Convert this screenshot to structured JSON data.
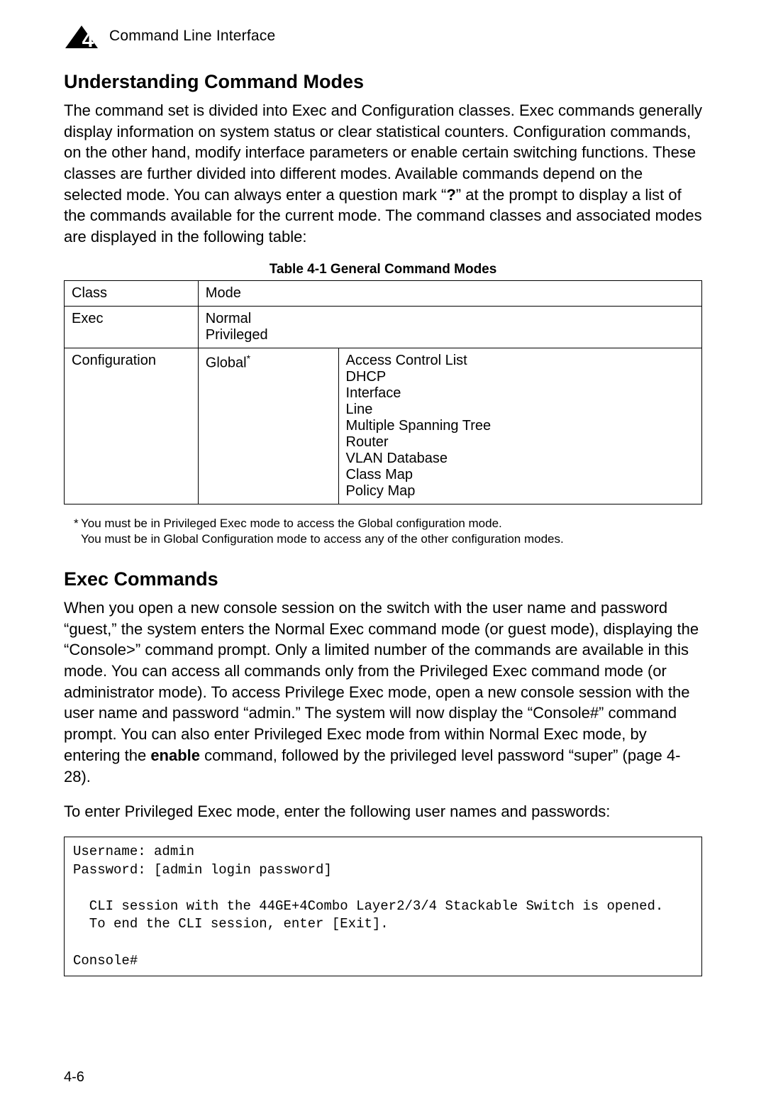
{
  "header": {
    "chapter_number": "4",
    "chapter_title": "Command Line Interface"
  },
  "section1": {
    "heading": "Understanding Command Modes",
    "para_pre": "The command set is divided into Exec and Configuration classes. Exec commands generally display information on system status or clear statistical counters. Configuration commands, on the other hand, modify interface parameters or enable certain switching functions. These classes are further divided into different modes. Available commands depend on the selected mode. You can always enter a question mark “",
    "para_q": "?",
    "para_post": "” at the prompt to display a list of the commands available for the current mode. The command classes and associated modes are displayed in the following table:"
  },
  "table": {
    "caption": "Table 4-1   General Command Modes",
    "head_class": "Class",
    "head_mode": "Mode",
    "row1_class": "Exec",
    "row1_mode_a": "Normal",
    "row1_mode_b": "Privileged",
    "row2_class": "Configuration",
    "row2_mode": "Global",
    "row2_mode_sup": "*",
    "row2_submodes": [
      "Access Control List",
      "DHCP",
      "Interface",
      "Line",
      "Multiple Spanning Tree",
      "Router",
      "VLAN Database",
      "Class Map",
      "Policy Map"
    ]
  },
  "footnotes": {
    "fn1_mark": "*",
    "fn1_text": "You must be in Privileged Exec mode to access the Global configuration mode.",
    "fn2_text": "You must be in Global Configuration mode to access any of the other configuration modes."
  },
  "section2": {
    "heading": "Exec Commands",
    "para1_pre": "When you open a new console session on the switch with the user name and password “guest,” the system enters the Normal Exec command mode (or guest mode), displaying the “Console>” command prompt. Only a limited number of the commands are available in this mode. You can access all commands only from the Privileged Exec command mode (or administrator mode). To access Privilege Exec mode, open a new console session with the user name and password “admin.” The system will now display the “Console#” command prompt. You can also enter Privileged Exec mode from within Normal Exec mode, by entering the ",
    "para1_enable": "enable",
    "para1_post": " command, followed by the privileged level password “super” (page 4-28).",
    "para2": "To enter Privileged Exec mode, enter the following user names and passwords:"
  },
  "console": "Username: admin\nPassword: [admin login password]\n\n  CLI session with the 44GE+4Combo Layer2/3/4 Stackable Switch is opened.\n  To end the CLI session, enter [Exit].\n\nConsole#",
  "page_number": "4-6"
}
